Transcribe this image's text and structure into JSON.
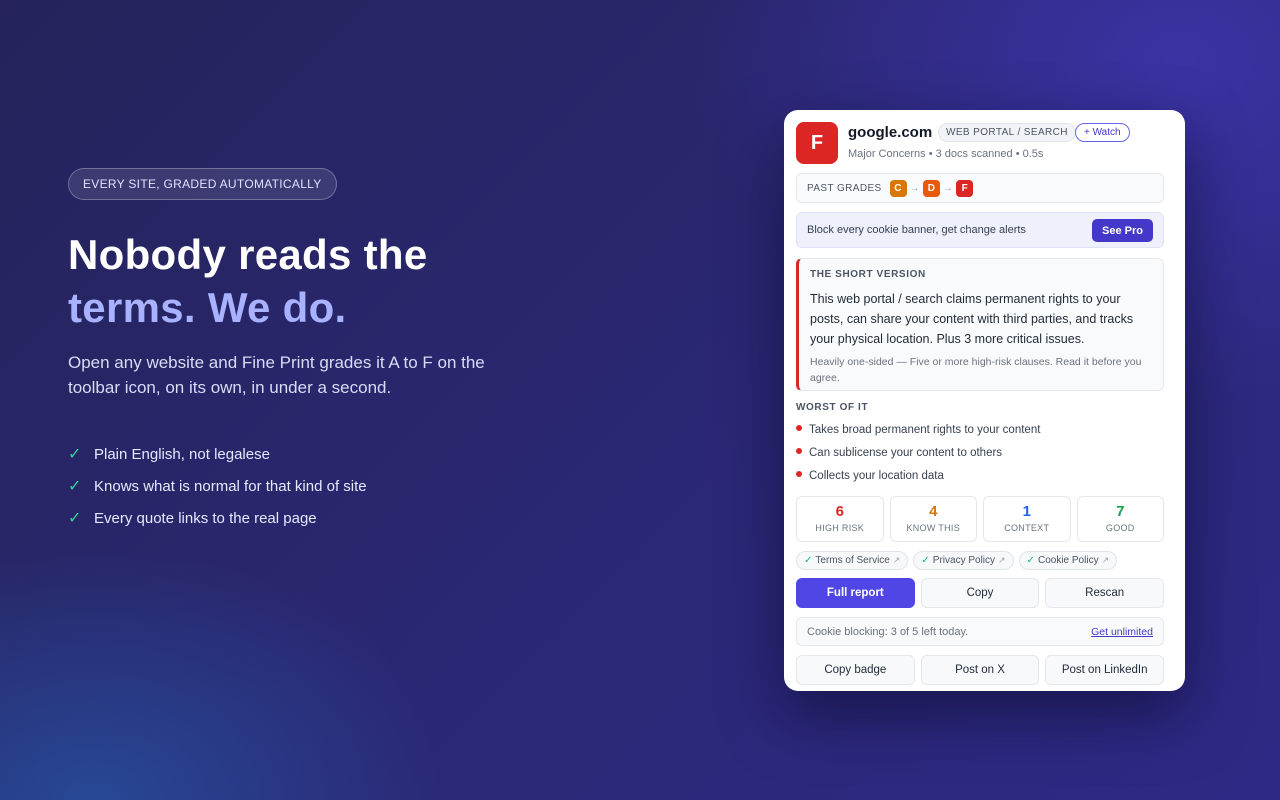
{
  "hero": {
    "tag": "EVERY SITE, GRADED AUTOMATICALLY",
    "headline_line1": "Nobody reads the",
    "headline_line2": "terms. We do.",
    "subcopy": "Open any website and Fine Print grades it A to F on the toolbar icon, on its own, in under a second.",
    "features": [
      "Plain English, not legalese",
      "Knows what is normal for that kind of site",
      "Every quote links to the real page"
    ],
    "check_glyph": "✓"
  },
  "card": {
    "grade": "F",
    "site": "google.com",
    "category": "WEB PORTAL / SEARCH",
    "watch_label": "+ Watch",
    "meta": "Major Concerns • 3 docs scanned • 0.5s",
    "past_grades_label": "PAST GRADES",
    "past_grades": [
      {
        "grade": "C",
        "color": "#d97706"
      },
      {
        "grade": "D",
        "color": "#ea580c"
      },
      {
        "grade": "F",
        "color": "#dc2626"
      }
    ],
    "arrow": "→",
    "promo_text": "Block every cookie banner, get change alerts",
    "promo_button": "See Pro",
    "short_title": "THE SHORT VERSION",
    "short_body": "This web portal / search claims permanent rights to your posts, can share your content with third parties, and tracks your physical location. Plus 3 more critical issues.",
    "short_note": "Heavily one-sided — Five or more high-risk clauses. Read it before you agree.",
    "worst_title": "WORST OF IT",
    "worst": [
      "Takes broad permanent rights to your content",
      "Can sublicense your content to others",
      "Collects your location data"
    ],
    "stats": [
      {
        "value": "6",
        "label": "HIGH RISK",
        "color": "#dc2626"
      },
      {
        "value": "4",
        "label": "KNOW THIS",
        "color": "#d97706"
      },
      {
        "value": "1",
        "label": "CONTEXT",
        "color": "#2563eb"
      },
      {
        "value": "7",
        "label": "GOOD",
        "color": "#16a34a"
      }
    ],
    "docs": [
      "Terms of Service",
      "Privacy Policy",
      "Cookie Policy"
    ],
    "doc_check": "✓",
    "doc_ext": "↗",
    "actions": {
      "full_report": "Full report",
      "copy": "Copy",
      "rescan": "Rescan"
    },
    "cookie_text": "Cookie blocking: 3 of 5 left today.",
    "cookie_link": "Get unlimited",
    "share": {
      "badge": "Copy badge",
      "x": "Post on X",
      "linkedin": "Post on LinkedIn"
    }
  }
}
